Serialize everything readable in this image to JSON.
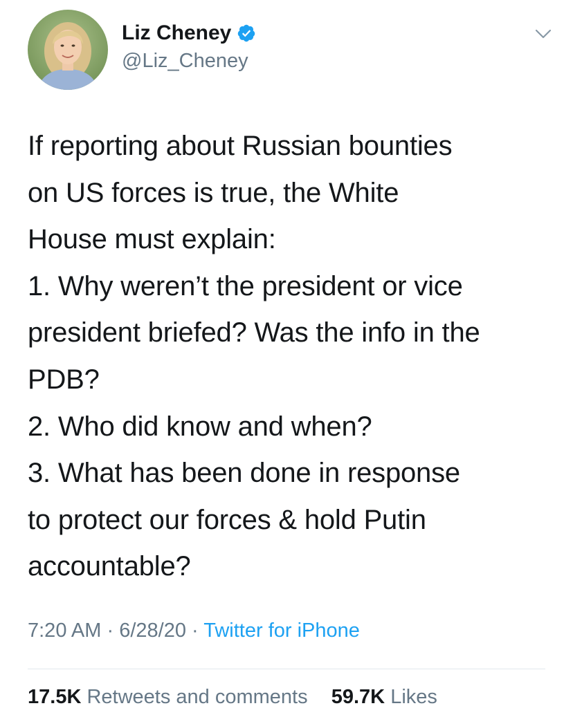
{
  "author": {
    "display_name": "Liz Cheney",
    "handle": "@Liz_Cheney",
    "verified": true,
    "verified_badge_color": "#1da1f2"
  },
  "tweet": {
    "lines": [
      "If reporting about Russian bounties",
      "on US forces is true, the White",
      "House must explain:",
      "1. Why weren’t the president or vice",
      "president briefed? Was the info in the",
      "PDB?",
      "2. Who did know and when?",
      "3. What has been done in response",
      "to protect our forces & hold Putin",
      "accountable?"
    ]
  },
  "meta": {
    "time": "7:20 AM",
    "separator": "·",
    "date": "6/28/20",
    "source": "Twitter for iPhone"
  },
  "stats": {
    "retweets_count": "17.5K",
    "retweets_label": "Retweets and comments",
    "likes_count": "59.7K",
    "likes_label": "Likes"
  },
  "colors": {
    "text_primary": "#14171a",
    "text_secondary": "#657786",
    "link": "#1da1f2",
    "divider": "#e1e8ed"
  },
  "icons": {
    "verified": "verified-badge-icon",
    "menu": "chevron-down-icon"
  }
}
